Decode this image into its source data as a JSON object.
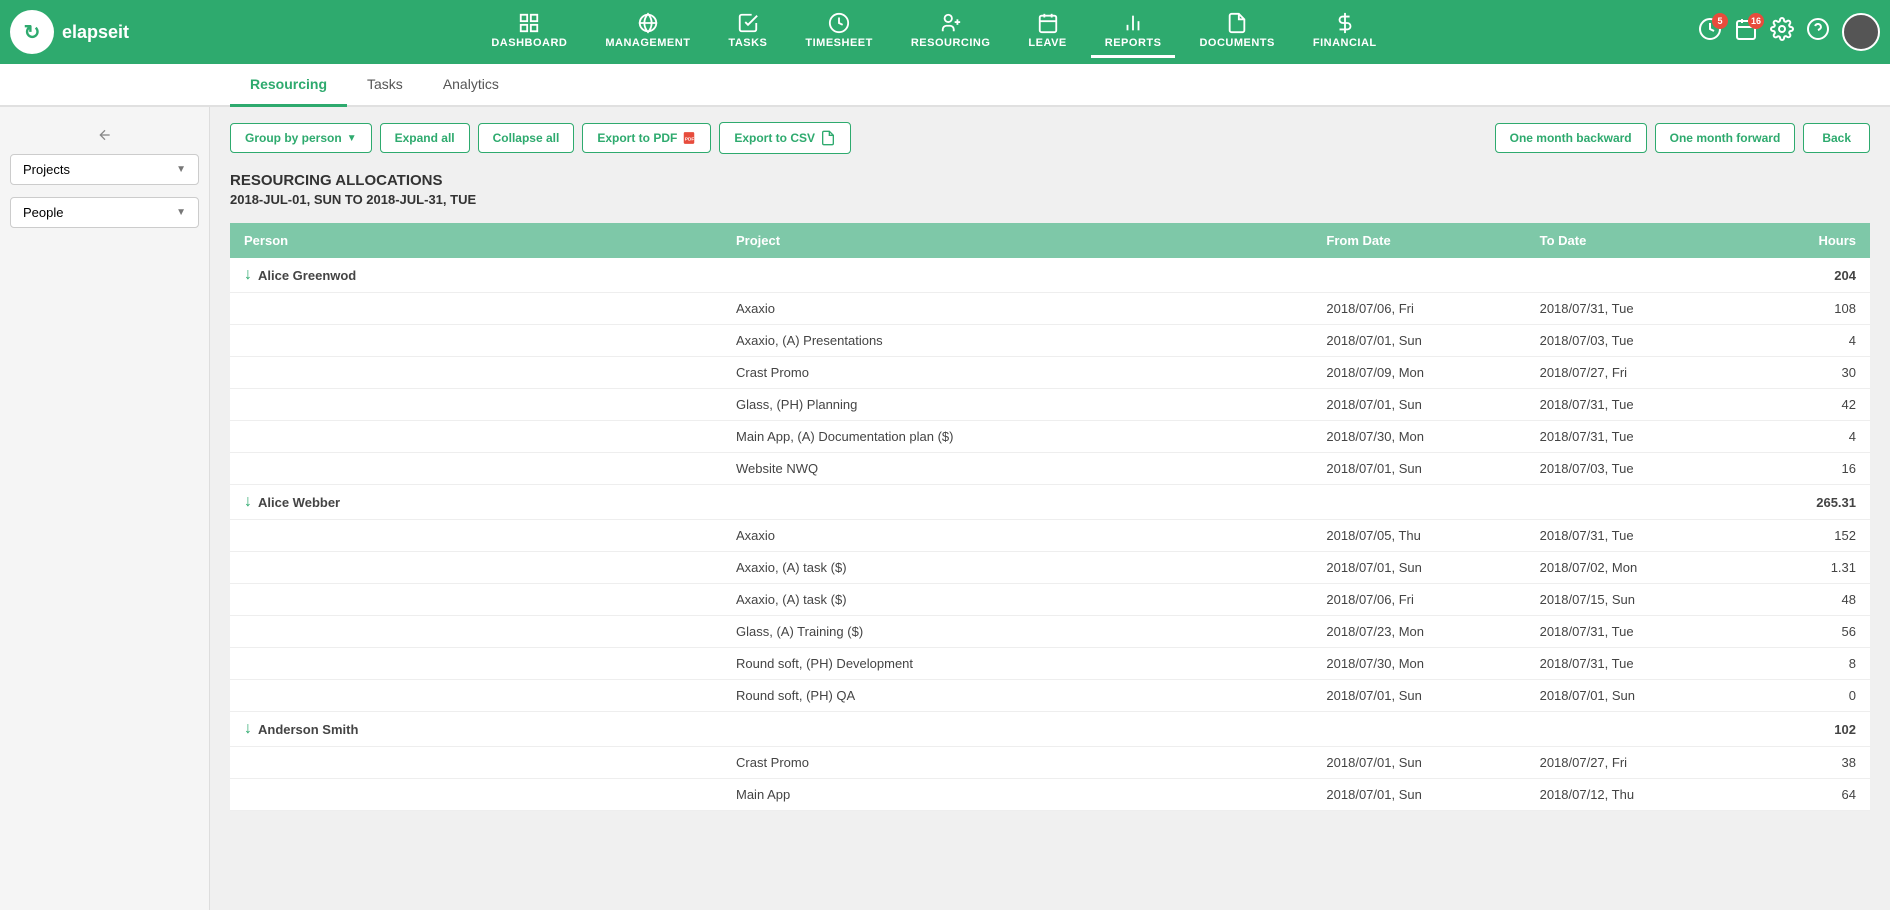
{
  "app": {
    "name": "elapseit"
  },
  "nav": {
    "items": [
      {
        "id": "dashboard",
        "label": "DASHBOARD",
        "active": false
      },
      {
        "id": "management",
        "label": "MANAGEMENT",
        "active": false
      },
      {
        "id": "tasks",
        "label": "TASKS",
        "active": false
      },
      {
        "id": "timesheet",
        "label": "TIMESHEET",
        "active": false
      },
      {
        "id": "resourcing",
        "label": "RESOURCING",
        "active": false
      },
      {
        "id": "leave",
        "label": "LEAVE",
        "active": false
      },
      {
        "id": "reports",
        "label": "REPORTS",
        "active": true
      },
      {
        "id": "documents",
        "label": "DOCUMENTS",
        "active": false
      },
      {
        "id": "financial",
        "label": "FINANCIAL",
        "active": false
      }
    ],
    "badge_alert": "5",
    "badge_calendar": "16"
  },
  "subtabs": [
    {
      "id": "resourcing",
      "label": "Resourcing",
      "active": true
    },
    {
      "id": "tasks",
      "label": "Tasks",
      "active": false
    },
    {
      "id": "analytics",
      "label": "Analytics",
      "active": false
    }
  ],
  "sidebar": {
    "projects_btn": "Projects",
    "people_btn": "People"
  },
  "toolbar": {
    "group_by_person": "Group by person",
    "expand_all": "Expand all",
    "collapse_all": "Collapse all",
    "export_pdf": "Export to PDF",
    "export_csv": "Export to CSV",
    "one_month_backward": "One month backward",
    "one_month_forward": "One month forward",
    "back": "Back"
  },
  "report": {
    "title": "RESOURCING ALLOCATIONS",
    "subtitle": "2018-JUL-01, SUN TO 2018-JUL-31, TUE"
  },
  "table": {
    "headers": [
      "Person",
      "Project",
      "From Date",
      "To Date",
      "Hours"
    ],
    "rows": [
      {
        "type": "person",
        "person": "Alice Greenwod",
        "project": "",
        "from_date": "",
        "to_date": "",
        "hours": "204"
      },
      {
        "type": "data",
        "person": "",
        "project": "Axaxio",
        "from_date": "2018/07/06, Fri",
        "to_date": "2018/07/31, Tue",
        "hours": "108"
      },
      {
        "type": "data",
        "person": "",
        "project": "Axaxio, (A) Presentations",
        "from_date": "2018/07/01, Sun",
        "to_date": "2018/07/03, Tue",
        "hours": "4"
      },
      {
        "type": "data",
        "person": "",
        "project": "Crast Promo",
        "from_date": "2018/07/09, Mon",
        "to_date": "2018/07/27, Fri",
        "hours": "30"
      },
      {
        "type": "data",
        "person": "",
        "project": "Glass, (PH) Planning",
        "from_date": "2018/07/01, Sun",
        "to_date": "2018/07/31, Tue",
        "hours": "42"
      },
      {
        "type": "data",
        "person": "",
        "project": "Main App, (A) Documentation plan ($)",
        "from_date": "2018/07/30, Mon",
        "to_date": "2018/07/31, Tue",
        "hours": "4"
      },
      {
        "type": "data",
        "person": "",
        "project": "Website NWQ",
        "from_date": "2018/07/01, Sun",
        "to_date": "2018/07/03, Tue",
        "hours": "16"
      },
      {
        "type": "person",
        "person": "Alice Webber",
        "project": "",
        "from_date": "",
        "to_date": "",
        "hours": "265.31"
      },
      {
        "type": "data",
        "person": "",
        "project": "Axaxio",
        "from_date": "2018/07/05, Thu",
        "to_date": "2018/07/31, Tue",
        "hours": "152"
      },
      {
        "type": "data",
        "person": "",
        "project": "Axaxio, (A) task ($)",
        "from_date": "2018/07/01, Sun",
        "to_date": "2018/07/02, Mon",
        "hours": "1.31"
      },
      {
        "type": "data",
        "person": "",
        "project": "Axaxio, (A) task ($)",
        "from_date": "2018/07/06, Fri",
        "to_date": "2018/07/15, Sun",
        "hours": "48"
      },
      {
        "type": "data",
        "person": "",
        "project": "Glass, (A) Training ($)",
        "from_date": "2018/07/23, Mon",
        "to_date": "2018/07/31, Tue",
        "hours": "56"
      },
      {
        "type": "data",
        "person": "",
        "project": "Round soft, (PH) Development",
        "from_date": "2018/07/30, Mon",
        "to_date": "2018/07/31, Tue",
        "hours": "8"
      },
      {
        "type": "data",
        "person": "",
        "project": "Round soft, (PH) QA",
        "from_date": "2018/07/01, Sun",
        "to_date": "2018/07/01, Sun",
        "hours": "0"
      },
      {
        "type": "person",
        "person": "Anderson Smith",
        "project": "",
        "from_date": "",
        "to_date": "",
        "hours": "102"
      },
      {
        "type": "data",
        "person": "",
        "project": "Crast Promo",
        "from_date": "2018/07/01, Sun",
        "to_date": "2018/07/27, Fri",
        "hours": "38"
      },
      {
        "type": "data",
        "person": "",
        "project": "Main App",
        "from_date": "2018/07/01, Sun",
        "to_date": "2018/07/12, Thu",
        "hours": "64"
      }
    ]
  },
  "colors": {
    "green": "#2eaa6e",
    "header_bg": "#7ec8a8",
    "active_underline": "#2eaa6e"
  }
}
